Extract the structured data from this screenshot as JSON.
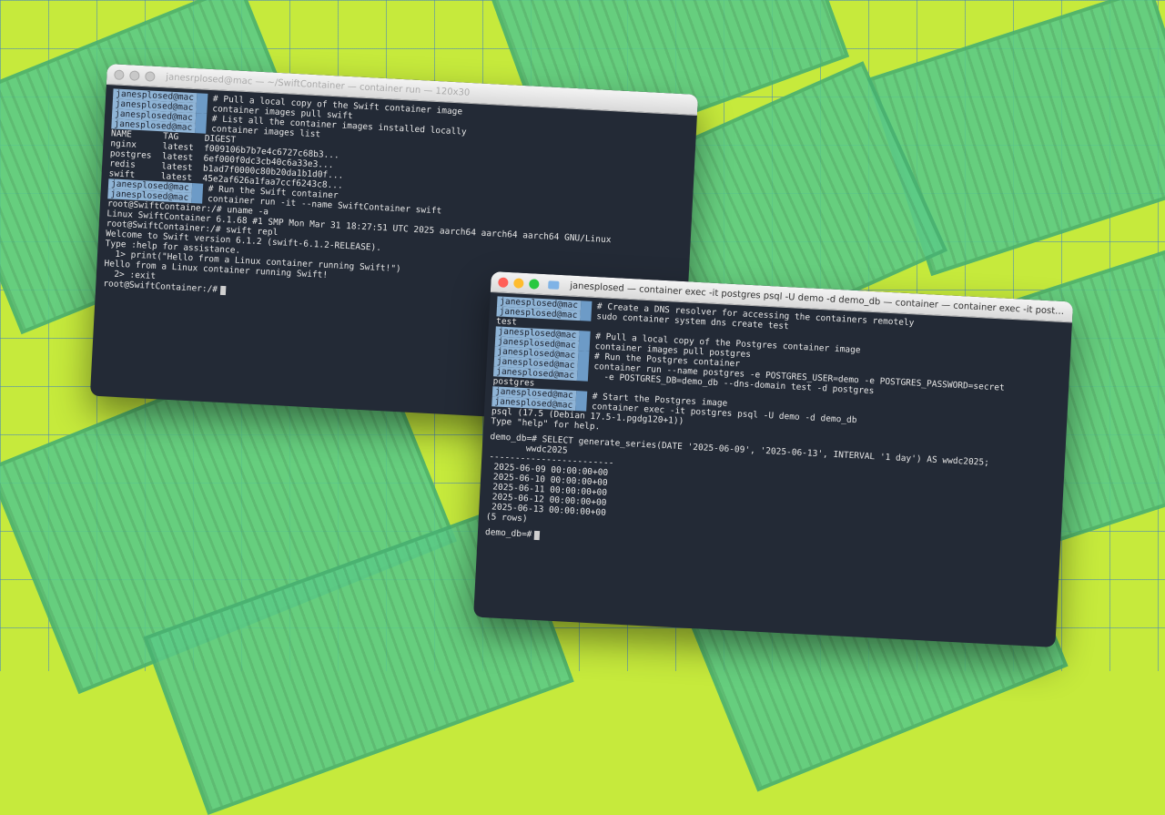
{
  "background": {
    "color": "#c6ea3c",
    "grid_color": "#4682be",
    "container_color": "#5ccb86"
  },
  "window1": {
    "title": "janesrplosed@mac — ~/SwiftContainer — container run — 120x30",
    "prompt": "janesplosed@mac",
    "block1": {
      "comment": "# Pull a local copy of the Swift container image",
      "command": "container images pull swift"
    },
    "block2": {
      "comment": "# List all the container images installed locally",
      "command": "container images list"
    },
    "table_header": "NAME      TAG     DIGEST",
    "table_rows": [
      "nginx     latest  f009106b7b7e4c6727c68b3...",
      "postgres  latest  6ef000f0dc3cb40c6a33e3...",
      "redis     latest  b1ad7f0000c80b20da1b1d0f...",
      "swift     latest  45e2af626a1faa7ccf6243c8..."
    ],
    "block3": {
      "comment": "# Run the Swift container",
      "command": "container run -it --name SwiftContainer swift"
    },
    "output": [
      "root@SwiftContainer:/# uname -a",
      "Linux SwiftContainer 6.1.68 #1 SMP Mon Mar 31 18:27:51 UTC 2025 aarch64 aarch64 aarch64 GNU/Linux",
      "root@SwiftContainer:/# swift repl",
      "Welcome to Swift version 6.1.2 (swift-6.1.2-RELEASE).",
      "Type :help for assistance.",
      "  1> print(\"Hello from a Linux container running Swift!\")",
      "Hello from a Linux container running Swift!",
      "  2> :exit"
    ],
    "final_prompt": "root@SwiftContainer:/#"
  },
  "window2": {
    "title": "janesplosed — container exec -it postgres psql -U demo -d demo_db — container — container exec -it postgres ps...",
    "prompt": "janesplosed@mac",
    "block1": {
      "comment": "# Create a DNS resolver for accessing the containers remotely",
      "command": "sudo container system dns create test"
    },
    "block1_tail": "test",
    "block2": {
      "comment": "# Pull a local copy of the Postgres container image",
      "command": "container images pull postgres"
    },
    "block3": {
      "comment": "# Run the Postgres container",
      "command": "container run --name postgres -e POSTGRES_USER=demo -e POSTGRES_PASSWORD=secret",
      "command2": "  -e POSTGRES_DB=demo_db --dns-domain test -d postgres"
    },
    "block3_tail": "postgres",
    "block4": {
      "comment": "# Start the Postgres image",
      "command": "container exec -it postgres psql -U demo -d demo_db"
    },
    "output": [
      "psql (17.5 (Debian 17.5-1.pgdg120+1))",
      "Type \"help\" for help."
    ],
    "query": "demo_db=# SELECT generate_series(DATE '2025-06-09', '2025-06-13', INTERVAL '1 day') AS wwdc2025;",
    "result_header": "       wwdc2025",
    "result_divider": "------------------------",
    "result_rows": [
      " 2025-06-09 00:00:00+00",
      " 2025-06-10 00:00:00+00",
      " 2025-06-11 00:00:00+00",
      " 2025-06-12 00:00:00+00",
      " 2025-06-13 00:00:00+00"
    ],
    "row_count": "(5 rows)",
    "final_prompt": "demo_db=#"
  }
}
